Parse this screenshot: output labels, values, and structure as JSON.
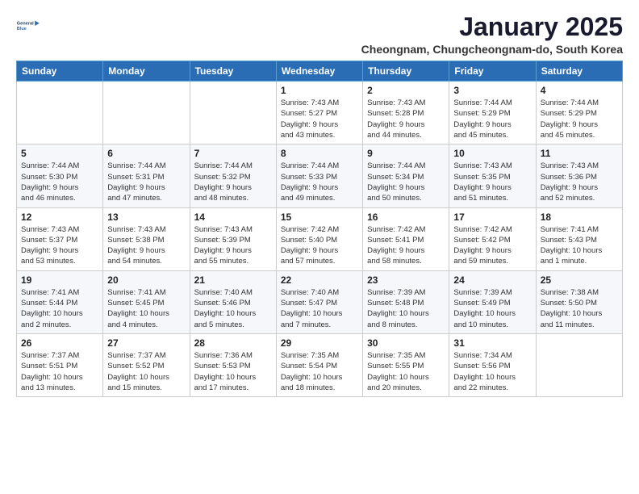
{
  "logo": {
    "line1": "General",
    "line2": "Blue"
  },
  "title": "January 2025",
  "location": "Cheongnam, Chungcheongnam-do, South Korea",
  "weekdays": [
    "Sunday",
    "Monday",
    "Tuesday",
    "Wednesday",
    "Thursday",
    "Friday",
    "Saturday"
  ],
  "weeks": [
    [
      {
        "day": "",
        "info": ""
      },
      {
        "day": "",
        "info": ""
      },
      {
        "day": "",
        "info": ""
      },
      {
        "day": "1",
        "info": "Sunrise: 7:43 AM\nSunset: 5:27 PM\nDaylight: 9 hours\nand 43 minutes."
      },
      {
        "day": "2",
        "info": "Sunrise: 7:43 AM\nSunset: 5:28 PM\nDaylight: 9 hours\nand 44 minutes."
      },
      {
        "day": "3",
        "info": "Sunrise: 7:44 AM\nSunset: 5:29 PM\nDaylight: 9 hours\nand 45 minutes."
      },
      {
        "day": "4",
        "info": "Sunrise: 7:44 AM\nSunset: 5:29 PM\nDaylight: 9 hours\nand 45 minutes."
      }
    ],
    [
      {
        "day": "5",
        "info": "Sunrise: 7:44 AM\nSunset: 5:30 PM\nDaylight: 9 hours\nand 46 minutes."
      },
      {
        "day": "6",
        "info": "Sunrise: 7:44 AM\nSunset: 5:31 PM\nDaylight: 9 hours\nand 47 minutes."
      },
      {
        "day": "7",
        "info": "Sunrise: 7:44 AM\nSunset: 5:32 PM\nDaylight: 9 hours\nand 48 minutes."
      },
      {
        "day": "8",
        "info": "Sunrise: 7:44 AM\nSunset: 5:33 PM\nDaylight: 9 hours\nand 49 minutes."
      },
      {
        "day": "9",
        "info": "Sunrise: 7:44 AM\nSunset: 5:34 PM\nDaylight: 9 hours\nand 50 minutes."
      },
      {
        "day": "10",
        "info": "Sunrise: 7:43 AM\nSunset: 5:35 PM\nDaylight: 9 hours\nand 51 minutes."
      },
      {
        "day": "11",
        "info": "Sunrise: 7:43 AM\nSunset: 5:36 PM\nDaylight: 9 hours\nand 52 minutes."
      }
    ],
    [
      {
        "day": "12",
        "info": "Sunrise: 7:43 AM\nSunset: 5:37 PM\nDaylight: 9 hours\nand 53 minutes."
      },
      {
        "day": "13",
        "info": "Sunrise: 7:43 AM\nSunset: 5:38 PM\nDaylight: 9 hours\nand 54 minutes."
      },
      {
        "day": "14",
        "info": "Sunrise: 7:43 AM\nSunset: 5:39 PM\nDaylight: 9 hours\nand 55 minutes."
      },
      {
        "day": "15",
        "info": "Sunrise: 7:42 AM\nSunset: 5:40 PM\nDaylight: 9 hours\nand 57 minutes."
      },
      {
        "day": "16",
        "info": "Sunrise: 7:42 AM\nSunset: 5:41 PM\nDaylight: 9 hours\nand 58 minutes."
      },
      {
        "day": "17",
        "info": "Sunrise: 7:42 AM\nSunset: 5:42 PM\nDaylight: 9 hours\nand 59 minutes."
      },
      {
        "day": "18",
        "info": "Sunrise: 7:41 AM\nSunset: 5:43 PM\nDaylight: 10 hours\nand 1 minute."
      }
    ],
    [
      {
        "day": "19",
        "info": "Sunrise: 7:41 AM\nSunset: 5:44 PM\nDaylight: 10 hours\nand 2 minutes."
      },
      {
        "day": "20",
        "info": "Sunrise: 7:41 AM\nSunset: 5:45 PM\nDaylight: 10 hours\nand 4 minutes."
      },
      {
        "day": "21",
        "info": "Sunrise: 7:40 AM\nSunset: 5:46 PM\nDaylight: 10 hours\nand 5 minutes."
      },
      {
        "day": "22",
        "info": "Sunrise: 7:40 AM\nSunset: 5:47 PM\nDaylight: 10 hours\nand 7 minutes."
      },
      {
        "day": "23",
        "info": "Sunrise: 7:39 AM\nSunset: 5:48 PM\nDaylight: 10 hours\nand 8 minutes."
      },
      {
        "day": "24",
        "info": "Sunrise: 7:39 AM\nSunset: 5:49 PM\nDaylight: 10 hours\nand 10 minutes."
      },
      {
        "day": "25",
        "info": "Sunrise: 7:38 AM\nSunset: 5:50 PM\nDaylight: 10 hours\nand 11 minutes."
      }
    ],
    [
      {
        "day": "26",
        "info": "Sunrise: 7:37 AM\nSunset: 5:51 PM\nDaylight: 10 hours\nand 13 minutes."
      },
      {
        "day": "27",
        "info": "Sunrise: 7:37 AM\nSunset: 5:52 PM\nDaylight: 10 hours\nand 15 minutes."
      },
      {
        "day": "28",
        "info": "Sunrise: 7:36 AM\nSunset: 5:53 PM\nDaylight: 10 hours\nand 17 minutes."
      },
      {
        "day": "29",
        "info": "Sunrise: 7:35 AM\nSunset: 5:54 PM\nDaylight: 10 hours\nand 18 minutes."
      },
      {
        "day": "30",
        "info": "Sunrise: 7:35 AM\nSunset: 5:55 PM\nDaylight: 10 hours\nand 20 minutes."
      },
      {
        "day": "31",
        "info": "Sunrise: 7:34 AM\nSunset: 5:56 PM\nDaylight: 10 hours\nand 22 minutes."
      },
      {
        "day": "",
        "info": ""
      }
    ]
  ]
}
